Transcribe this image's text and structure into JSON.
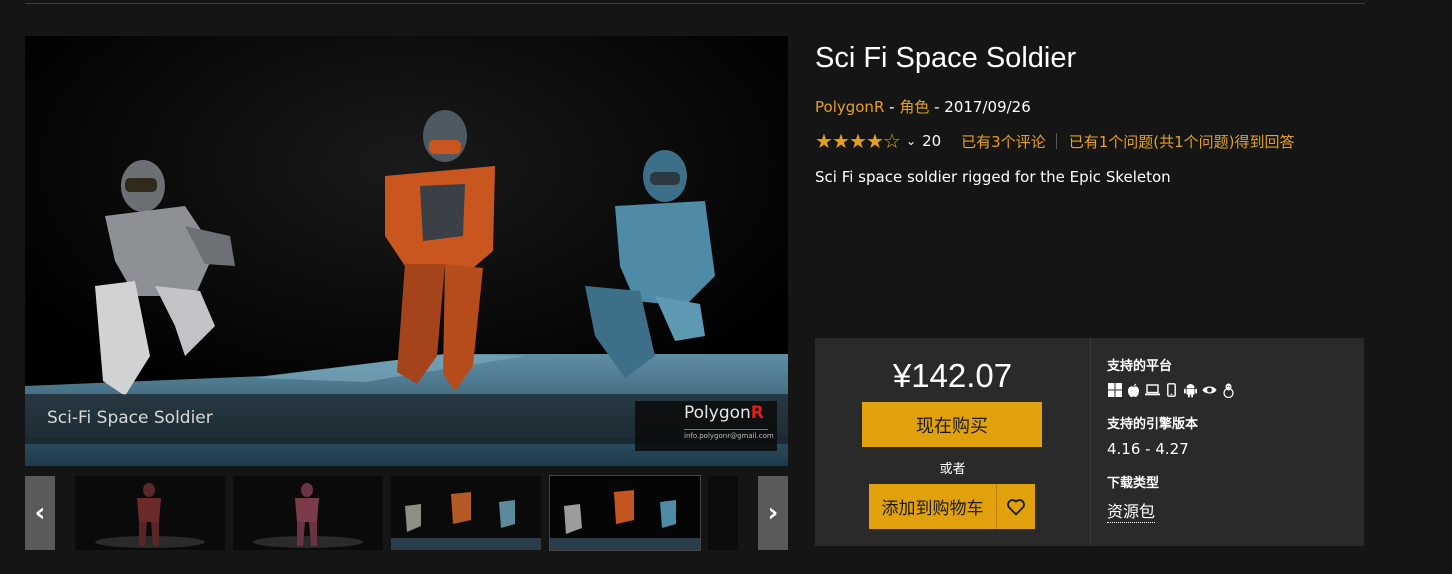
{
  "product": {
    "title": "Sci Fi Space Soldier",
    "seller": "PolygonR",
    "separator1": " - ",
    "category": "角色",
    "separator2": " - ",
    "date": "2017/09/26",
    "rating_stars": 4,
    "rating_max": 5,
    "rating_count": "20",
    "reviews_link": "已有3个评论",
    "questions_link": "已有1个问题(共1个问题)得到回答",
    "description": "Sci Fi space soldier rigged for the Epic Skeleton"
  },
  "hero": {
    "caption": "Sci-Fi Space Soldier",
    "logo_text": "Polygon",
    "logo_accent": "R",
    "logo_email": "info.polygonr@gmail.com"
  },
  "purchase": {
    "price": "¥142.07",
    "buy_label": "现在购买",
    "or_label": "或者",
    "cart_label": "添加到购物车"
  },
  "info": {
    "platforms_label": "支持的平台",
    "platform_icons": [
      "windows-icon",
      "apple-icon",
      "laptop-icon",
      "phone-icon",
      "android-icon",
      "vr-eye-icon",
      "linux-icon"
    ],
    "engine_label": "支持的引擎版本",
    "engine_value": "4.16 - 4.27",
    "download_label": "下载类型",
    "download_value": "资源包"
  },
  "colors": {
    "accent": "#e0a10c",
    "link": "#e6a01e",
    "background": "#151515",
    "panel": "#2a2a2a"
  }
}
